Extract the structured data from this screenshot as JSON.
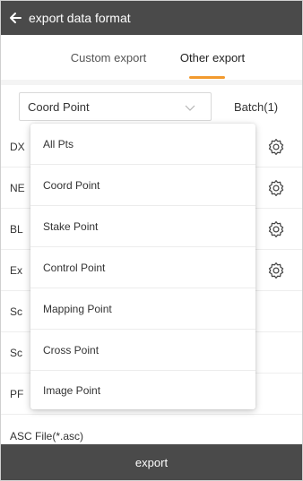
{
  "header": {
    "title": "export data format",
    "back_icon": "arrow-left-icon"
  },
  "tabs": [
    {
      "label": "Custom export",
      "active": false
    },
    {
      "label": "Other export",
      "active": true
    }
  ],
  "filter": {
    "selected_point_type": "Coord Point",
    "caret_icon": "chevron-down-icon",
    "batch_label": "Batch(1)"
  },
  "formats": [
    {
      "label": "DX",
      "has_settings": true
    },
    {
      "label": "NE",
      "has_settings": true
    },
    {
      "label": "BL",
      "has_settings": true
    },
    {
      "label": "Ex",
      "has_settings": true
    },
    {
      "label": "Sc",
      "has_settings": false
    },
    {
      "label": "Sc",
      "has_settings": false
    },
    {
      "label": "PF",
      "has_settings": false
    },
    {
      "label": "ASC File(*.asc)",
      "has_settings": false
    }
  ],
  "dropdown": {
    "options": [
      "All Pts",
      "Coord Point",
      "Stake Point",
      "Control Point",
      "Mapping Point",
      "Cross Point",
      "Image Point"
    ]
  },
  "footer": {
    "export_label": "export"
  },
  "colors": {
    "bar": "#4a4a4a",
    "accent": "#f29a2e"
  }
}
